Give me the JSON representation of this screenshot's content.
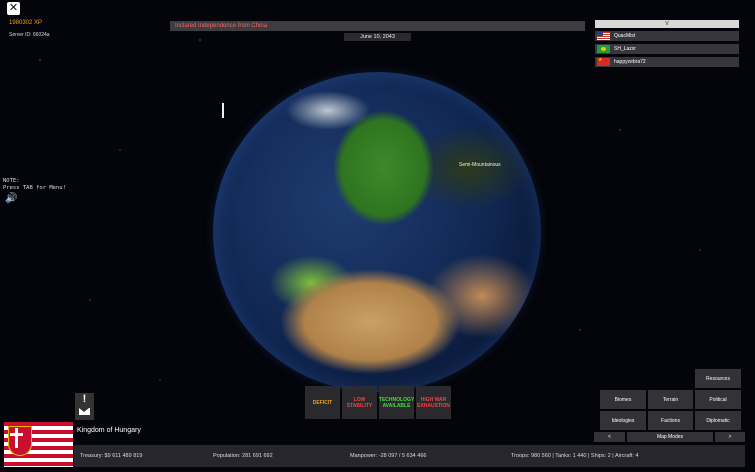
{
  "header": {
    "close_label": "✕",
    "xp": "1980302 XP",
    "server_id": "Server ID: 66024a",
    "notification": "Inclared Independence from China",
    "date": "June 10, 2043"
  },
  "players": {
    "toggle_label": "V",
    "list": [
      {
        "name": "QuacMist",
        "flag_icon": "us-flag-icon"
      },
      {
        "name": "SH_Lazxr",
        "flag_icon": "brazil-flag-icon"
      },
      {
        "name": "happyzebra72",
        "flag_icon": "china-flag-icon"
      }
    ]
  },
  "note": "NOTE:\nPress TAB for Menu!",
  "map": {
    "region_label": "Semi-Mountainous"
  },
  "status": [
    {
      "label": "DEFICIT",
      "color": "#e8a020"
    },
    {
      "label": "LOW STABILITY",
      "color": "#ff4040"
    },
    {
      "label": "TECHNOLOGY AVAILABLE",
      "color": "#40e040"
    },
    {
      "label": "HIGH WAR EXHAUSTION",
      "color": "#ff4040"
    }
  ],
  "map_modes": {
    "resources": "Resources",
    "biomes": "Biomes",
    "terrain": "Terrain",
    "political": "Political",
    "ideologies": "Ideologies",
    "factions": "Factions",
    "diplomatic": "Diplomatic",
    "prev": "<",
    "label": "Map Modes",
    "next": ">"
  },
  "country": {
    "name": "Kingdom of Hungary"
  },
  "stats": {
    "treasury": "Treasury:   $9 611 489 819",
    "population": "Population: 281 691 692",
    "manpower": "Manpower:   -28 097  /  5 634 466",
    "military": "Troops: 980 560  |  Tanks: 1 440  |  Ships: 2  |  Aircraft: 4"
  }
}
